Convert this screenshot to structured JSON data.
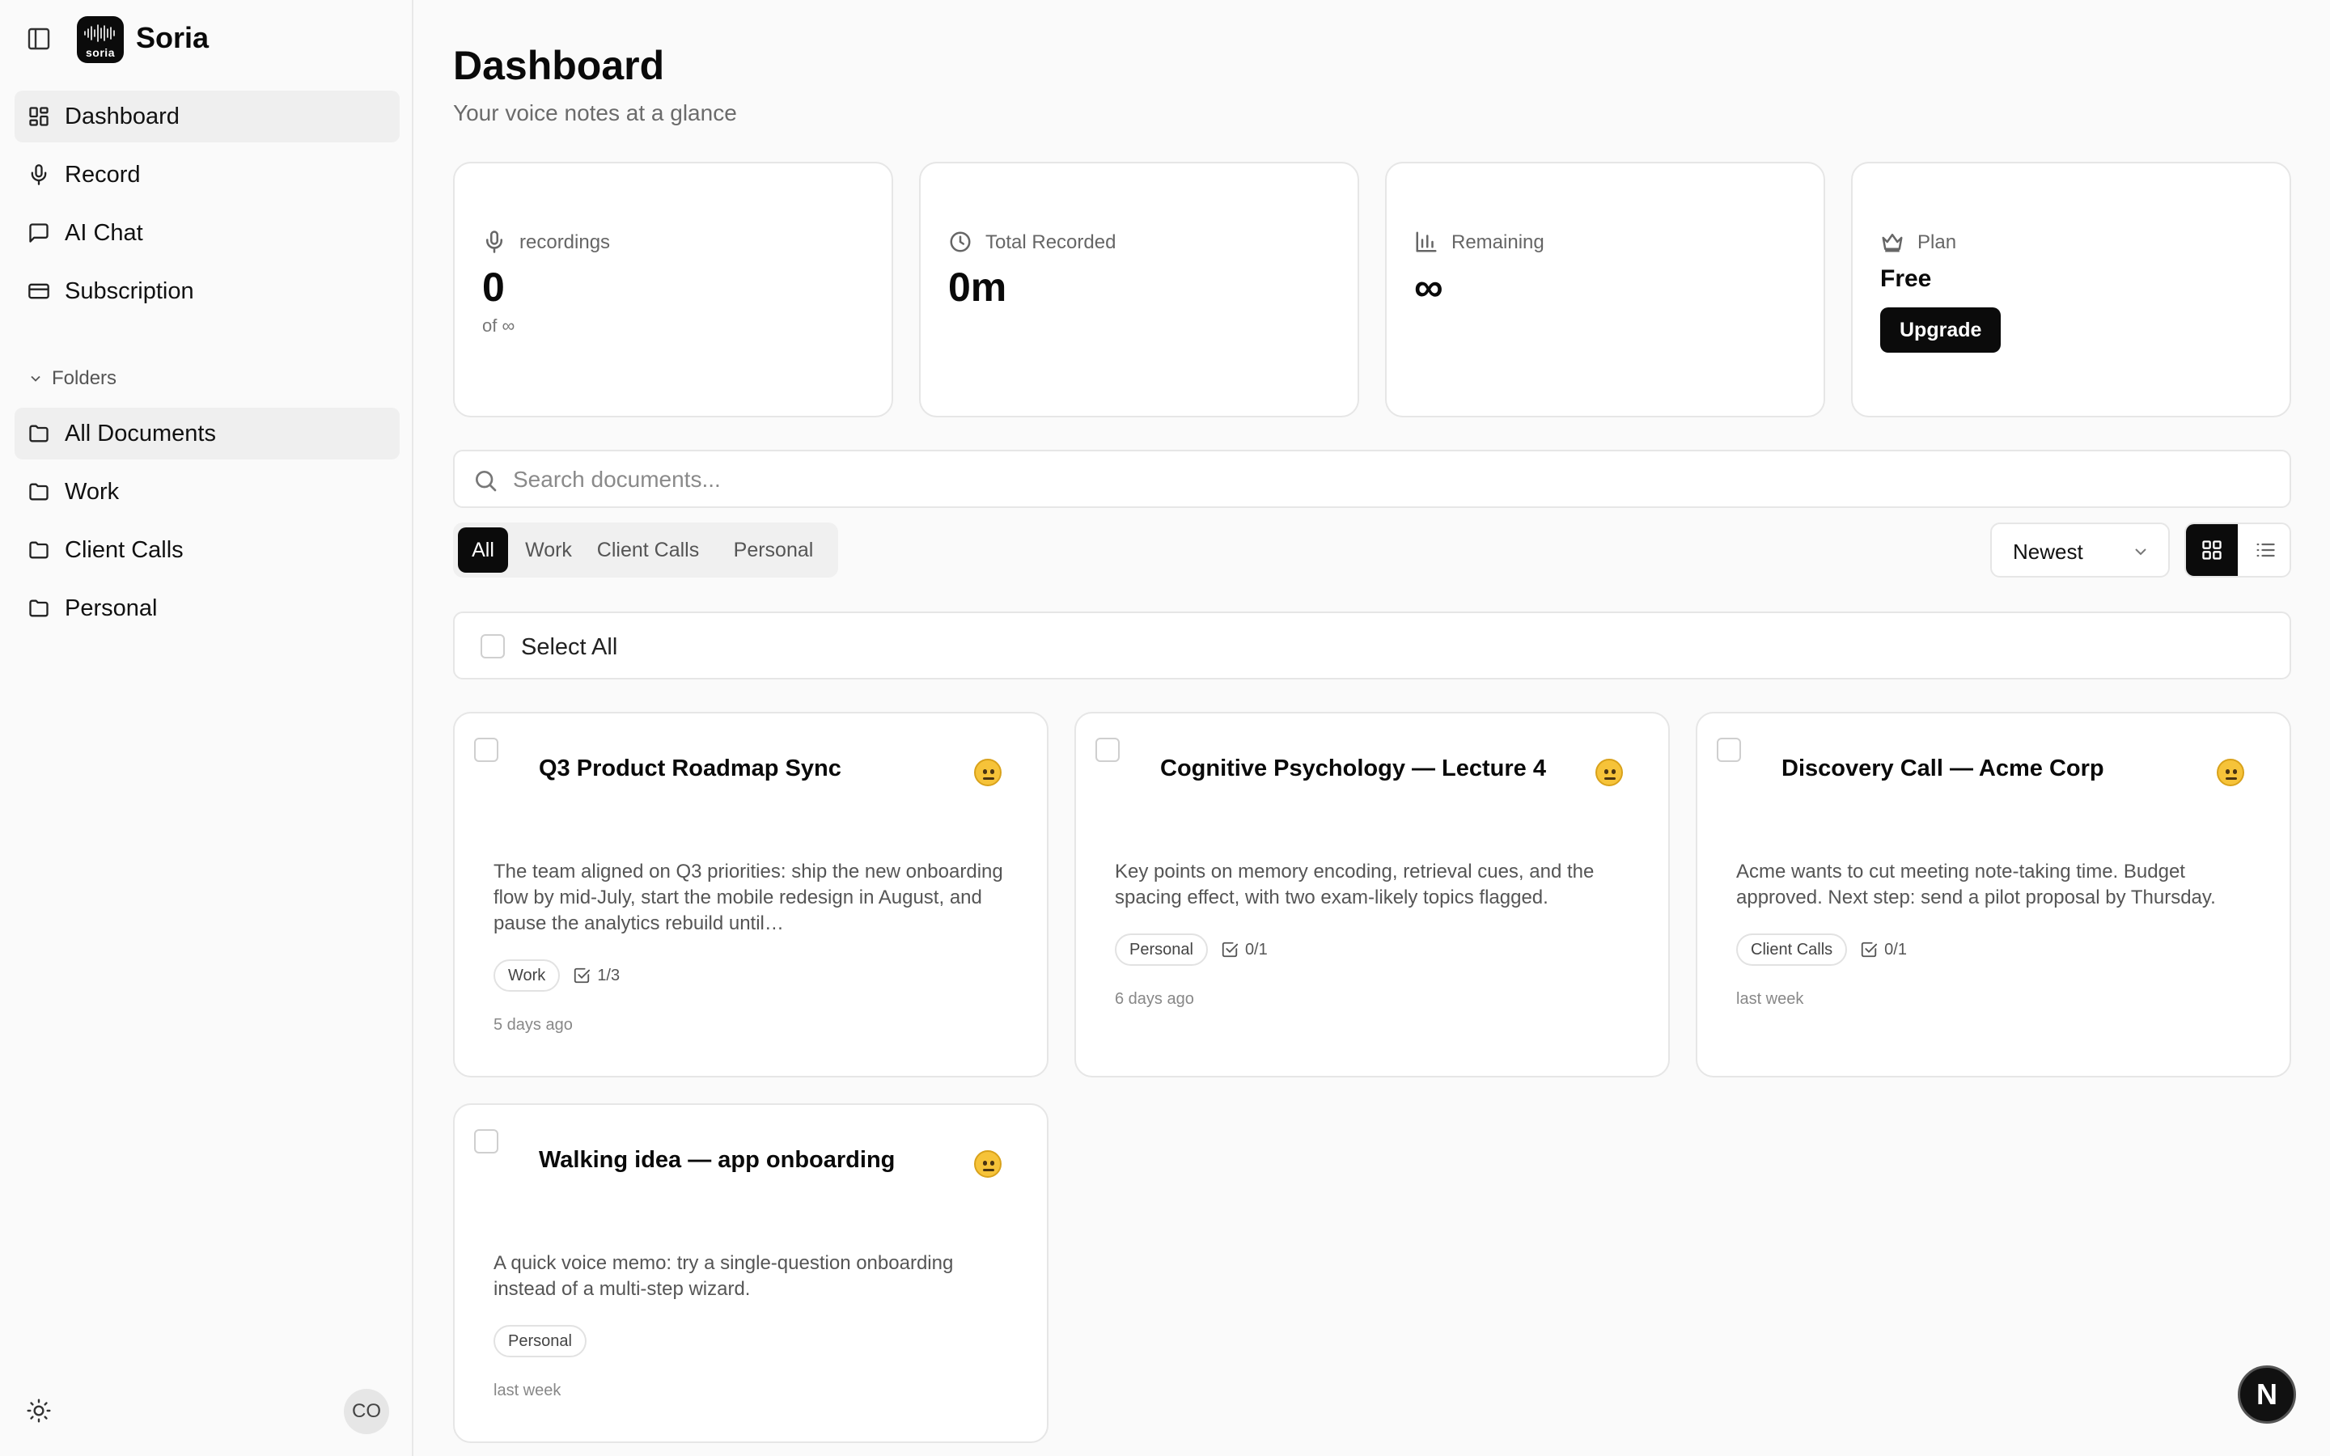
{
  "app": {
    "name": "Soria",
    "logo_text": "soria"
  },
  "sidebar": {
    "nav": [
      {
        "label": "Dashboard",
        "icon": "layout-dashboard-icon",
        "active": true
      },
      {
        "label": "Record",
        "icon": "microphone-icon",
        "active": false
      },
      {
        "label": "AI Chat",
        "icon": "message-square-icon",
        "active": false
      },
      {
        "label": "Subscription",
        "icon": "credit-card-icon",
        "active": false
      }
    ],
    "folders_heading": "Folders",
    "folders": [
      {
        "label": "All Documents",
        "icon": "folder-icon",
        "active": true
      },
      {
        "label": "Work",
        "icon": "folder-icon",
        "active": false
      },
      {
        "label": "Client Calls",
        "icon": "folder-icon",
        "active": false
      },
      {
        "label": "Personal",
        "icon": "folder-icon",
        "active": false
      }
    ],
    "avatar_initials": "CO"
  },
  "header": {
    "title": "Dashboard",
    "subtitle": "Your voice notes at a glance"
  },
  "stats": {
    "recordings": {
      "label": "recordings",
      "value": "0",
      "sub": "of ∞"
    },
    "total": {
      "label": "Total Recorded",
      "value": "0m"
    },
    "remaining": {
      "label": "Remaining",
      "value": "∞"
    },
    "plan": {
      "label": "Plan",
      "value": "Free",
      "button": "Upgrade"
    }
  },
  "search": {
    "placeholder": "Search documents...",
    "value": ""
  },
  "filter_tabs": [
    {
      "label": "All",
      "active": true
    },
    {
      "label": "Work",
      "active": false
    },
    {
      "label": "Client Calls",
      "active": false
    },
    {
      "label": "Personal",
      "active": false
    }
  ],
  "sort": {
    "selected": "Newest"
  },
  "view": {
    "mode": "grid"
  },
  "select_all_label": "Select All",
  "documents": [
    {
      "title": "Q3 Product Roadmap Sync",
      "summary": "The team aligned on Q3 priorities: ship the new onboarding flow by mid-July, start the mobile redesign in August, and pause the analytics rebuild until…",
      "tag": "Work",
      "tasks": "1/3",
      "time": "5 days ago",
      "sentiment": "neutral-face-emoji"
    },
    {
      "title": "Cognitive Psychology — Lecture 4",
      "summary": "Key points on memory encoding, retrieval cues, and the spacing effect, with two exam-likely topics flagged.",
      "tag": "Personal",
      "tasks": "0/1",
      "time": "6 days ago",
      "sentiment": "neutral-face-emoji"
    },
    {
      "title": "Discovery Call — Acme Corp",
      "summary": "Acme wants to cut meeting note-taking time. Budget approved. Next step: send a pilot proposal by Thursday.",
      "tag": "Client Calls",
      "tasks": "0/1",
      "time": "last week",
      "sentiment": "neutral-face-emoji"
    },
    {
      "title": "Walking idea — app onboarding",
      "summary": "A quick voice memo: try a single-question onboarding instead of a multi-step wizard.",
      "tag": "Personal",
      "tasks": null,
      "time": "last week",
      "sentiment": "neutral-face-emoji"
    }
  ],
  "dev_badge": "N",
  "colors": {
    "accent": "#0b0b0b",
    "background": "#fafafa",
    "card": "#ffffff",
    "border": "#e6e6e6",
    "muted": "#6b6b6b",
    "emoji": "#f6c339"
  }
}
